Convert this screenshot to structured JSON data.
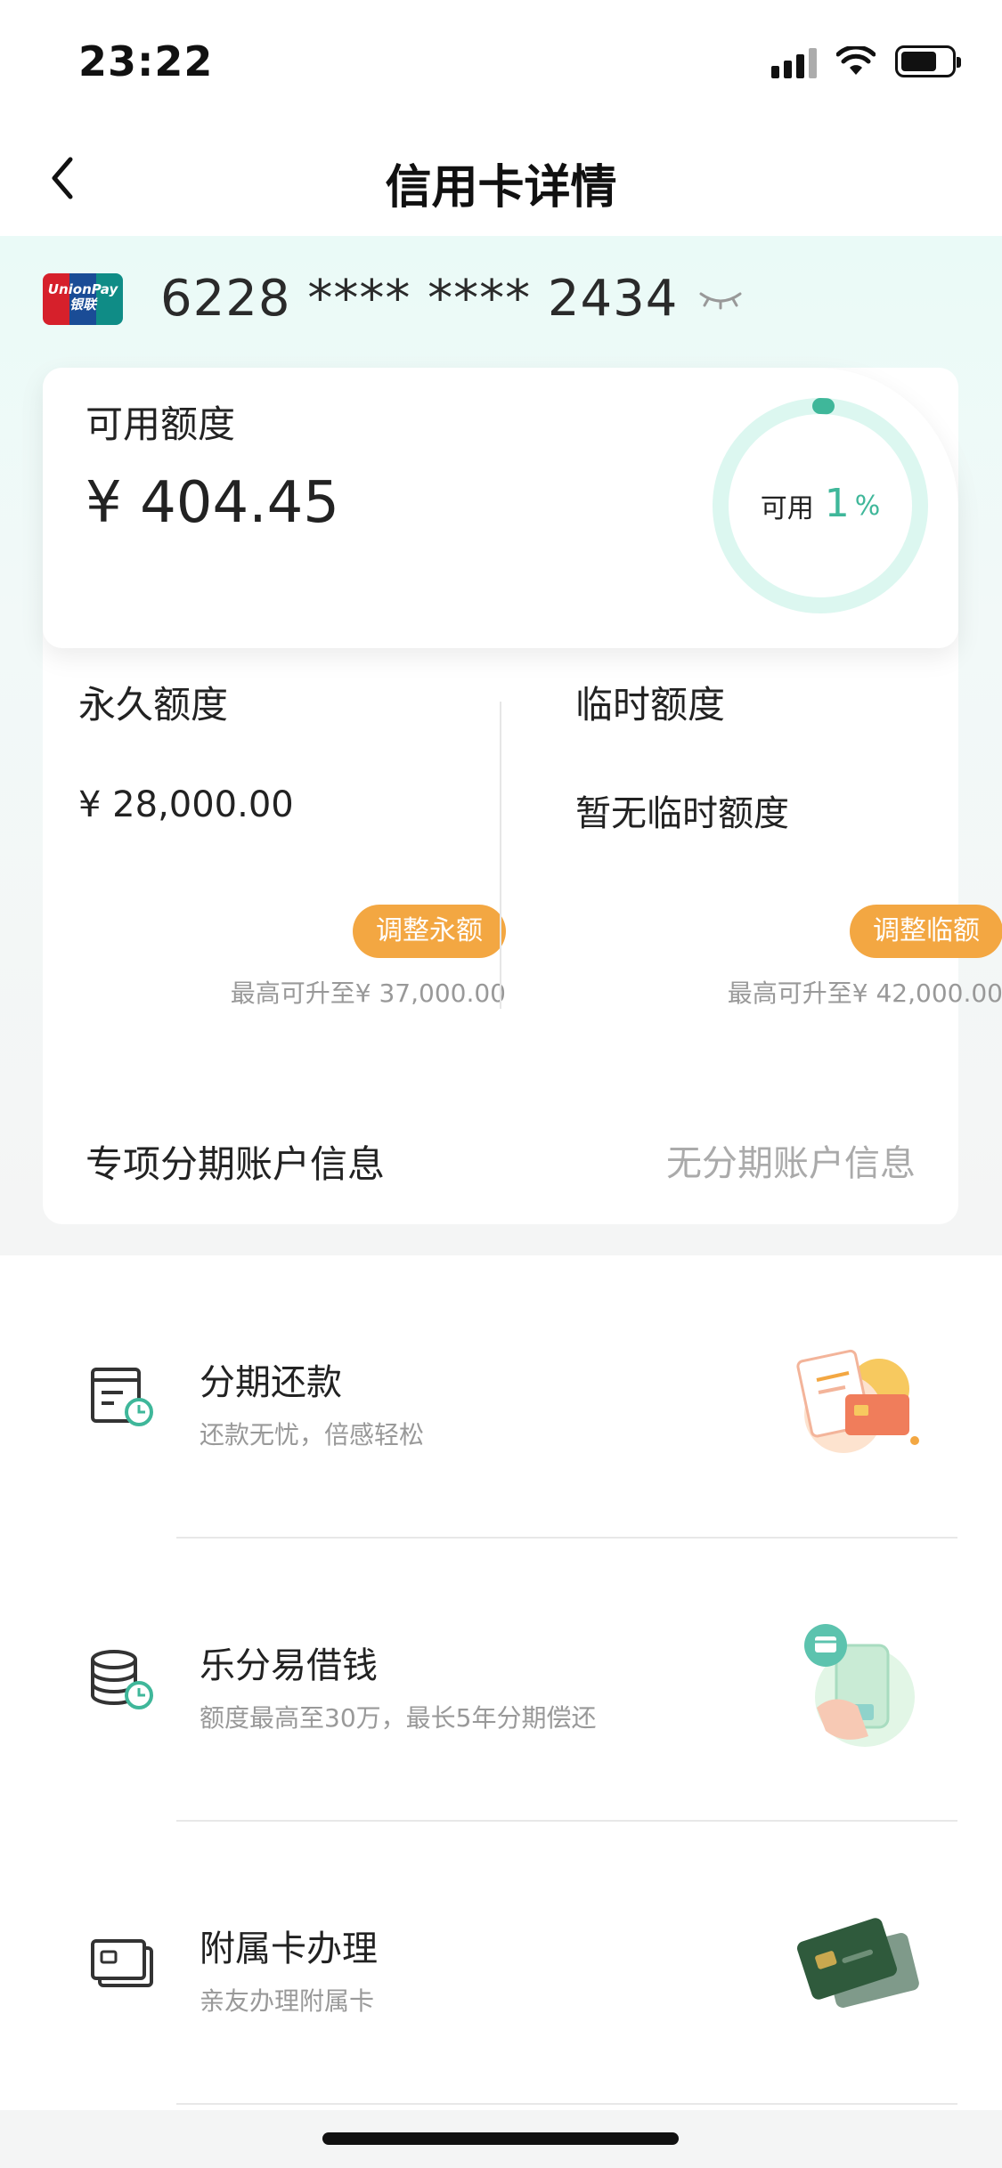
{
  "status_bar": {
    "time": "23:22"
  },
  "nav": {
    "title": "信用卡详情"
  },
  "card": {
    "brand_text": "UnionPay 银联",
    "number": "6228 **** **** 2434"
  },
  "available": {
    "label": "可用额度",
    "amount": "¥ 404.45",
    "ring_label": "可用",
    "ring_percent": "1",
    "ring_unit": "%",
    "ring_fraction": 0.01,
    "accent": "#3fb79a"
  },
  "permanent": {
    "title": "永久额度",
    "value": "¥ 28,000.00",
    "button": "调整永额",
    "max_note": "最高可升至¥ 37,000.00"
  },
  "temporary": {
    "title": "临时额度",
    "value": "暂无临时额度",
    "button": "调整临额",
    "max_note": "最高可升至¥ 42,000.00"
  },
  "installment_account": {
    "label": "专项分期账户信息",
    "value": "无分期账户信息"
  },
  "services": [
    {
      "title": "分期还款",
      "desc": "还款无忧，倍感轻松",
      "icon": "bill-clock-icon"
    },
    {
      "title": "乐分易借钱",
      "desc": "额度最高至30万，最长5年分期偿还",
      "icon": "coins-clock-icon"
    },
    {
      "title": "附属卡办理",
      "desc": "亲友办理附属卡",
      "icon": "card-icon"
    }
  ],
  "colors": {
    "accent_green": "#3fb79a",
    "button_orange": "#f3a742"
  }
}
